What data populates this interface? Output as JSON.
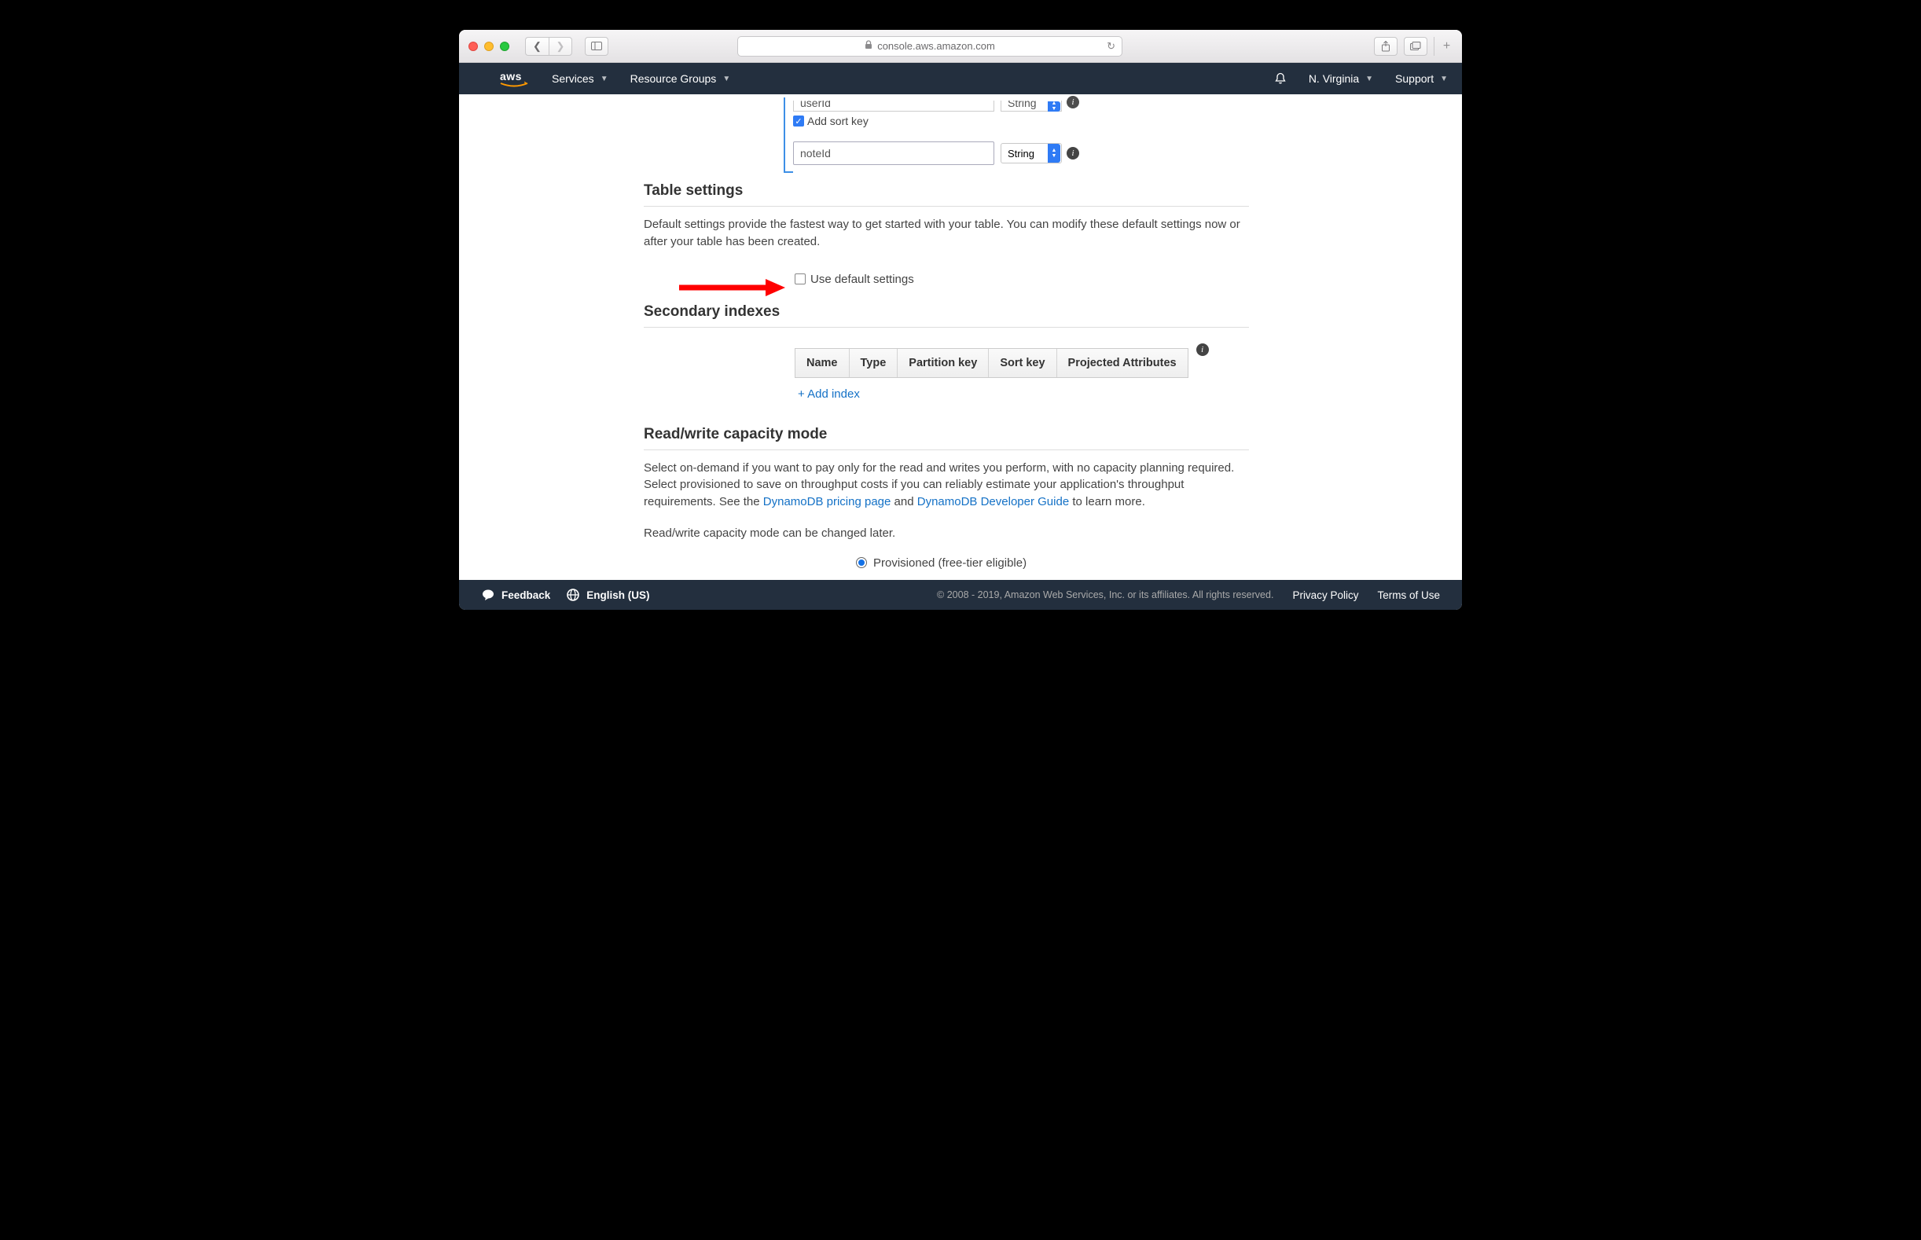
{
  "browser": {
    "url": "console.aws.amazon.com"
  },
  "awsNav": {
    "services": "Services",
    "resourceGroups": "Resource Groups",
    "region": "N. Virginia",
    "support": "Support"
  },
  "keys": {
    "partitionValue": "userId",
    "partitionType": "String",
    "addSortKeyLabel": "Add sort key",
    "addSortKeyChecked": true,
    "sortValue": "noteId",
    "sortType": "String"
  },
  "tableSettings": {
    "heading": "Table settings",
    "desc": "Default settings provide the fastest way to get started with your table. You can modify these default settings now or after your table has been created.",
    "useDefaultLabel": "Use default settings",
    "useDefaultChecked": false
  },
  "secondaryIndexes": {
    "heading": "Secondary indexes",
    "columns": [
      "Name",
      "Type",
      "Partition key",
      "Sort key",
      "Projected Attributes"
    ],
    "addIndexLabel": "+ Add index"
  },
  "capacity": {
    "heading": "Read/write capacity mode",
    "descPrefix": "Select on-demand if you want to pay only for the read and writes you perform, with no capacity planning required. Select provisioned to save on throughput costs if you can reliably estimate your application's throughput requirements. See the ",
    "linkPricing": "DynamoDB pricing page",
    "descMid": " and ",
    "linkGuide": "DynamoDB Developer Guide",
    "descSuffix": " to learn more.",
    "changeLater": "Read/write capacity mode can be changed later.",
    "optionProvisioned": "Provisioned (free-tier eligible)"
  },
  "footer": {
    "feedback": "Feedback",
    "language": "English (US)",
    "copyright": "© 2008 - 2019, Amazon Web Services, Inc. or its affiliates. All rights reserved.",
    "privacy": "Privacy Policy",
    "terms": "Terms of Use"
  }
}
